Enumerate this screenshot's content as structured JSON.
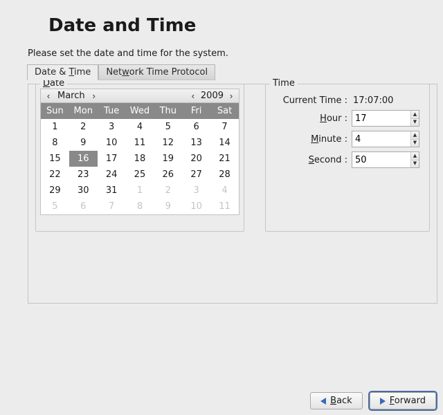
{
  "title": "Date and Time",
  "instruction": "Please set the date and time for the system.",
  "tabs": {
    "date_time_pre": "Date & ",
    "date_time_ul": "T",
    "date_time_post": "ime",
    "ntp_pre": "Net",
    "ntp_ul": "w",
    "ntp_post": "ork Time Protocol"
  },
  "date": {
    "legend_ul": "D",
    "legend_post": "ate",
    "month": "March",
    "year": "2009",
    "dow": [
      "Sun",
      "Mon",
      "Tue",
      "Wed",
      "Thu",
      "Fri",
      "Sat"
    ],
    "rows": [
      [
        {
          "d": "1"
        },
        {
          "d": "2"
        },
        {
          "d": "3"
        },
        {
          "d": "4"
        },
        {
          "d": "5"
        },
        {
          "d": "6"
        },
        {
          "d": "7"
        }
      ],
      [
        {
          "d": "8"
        },
        {
          "d": "9"
        },
        {
          "d": "10"
        },
        {
          "d": "11"
        },
        {
          "d": "12"
        },
        {
          "d": "13"
        },
        {
          "d": "14"
        }
      ],
      [
        {
          "d": "15"
        },
        {
          "d": "16",
          "sel": true
        },
        {
          "d": "17"
        },
        {
          "d": "18"
        },
        {
          "d": "19"
        },
        {
          "d": "20"
        },
        {
          "d": "21"
        }
      ],
      [
        {
          "d": "22"
        },
        {
          "d": "23"
        },
        {
          "d": "24"
        },
        {
          "d": "25"
        },
        {
          "d": "26"
        },
        {
          "d": "27"
        },
        {
          "d": "28"
        }
      ],
      [
        {
          "d": "29"
        },
        {
          "d": "30"
        },
        {
          "d": "31"
        },
        {
          "d": "1",
          "other": true
        },
        {
          "d": "2",
          "other": true
        },
        {
          "d": "3",
          "other": true
        },
        {
          "d": "4",
          "other": true
        }
      ],
      [
        {
          "d": "5",
          "other": true
        },
        {
          "d": "6",
          "other": true
        },
        {
          "d": "7",
          "other": true
        },
        {
          "d": "8",
          "other": true
        },
        {
          "d": "9",
          "other": true
        },
        {
          "d": "10",
          "other": true
        },
        {
          "d": "11",
          "other": true
        }
      ]
    ]
  },
  "time": {
    "legend": "Time",
    "current_label": "Current Time :",
    "current_value": "17:07:00",
    "hour_ul": "H",
    "hour_post": "our :",
    "minute_ul": "M",
    "minute_post": "inute :",
    "second_ul": "S",
    "second_post": "econd :",
    "hour": "17",
    "minute": "4",
    "second": "50"
  },
  "buttons": {
    "back_ul": "B",
    "back_post": "ack",
    "forward_ul": "F",
    "forward_post": "orward"
  }
}
